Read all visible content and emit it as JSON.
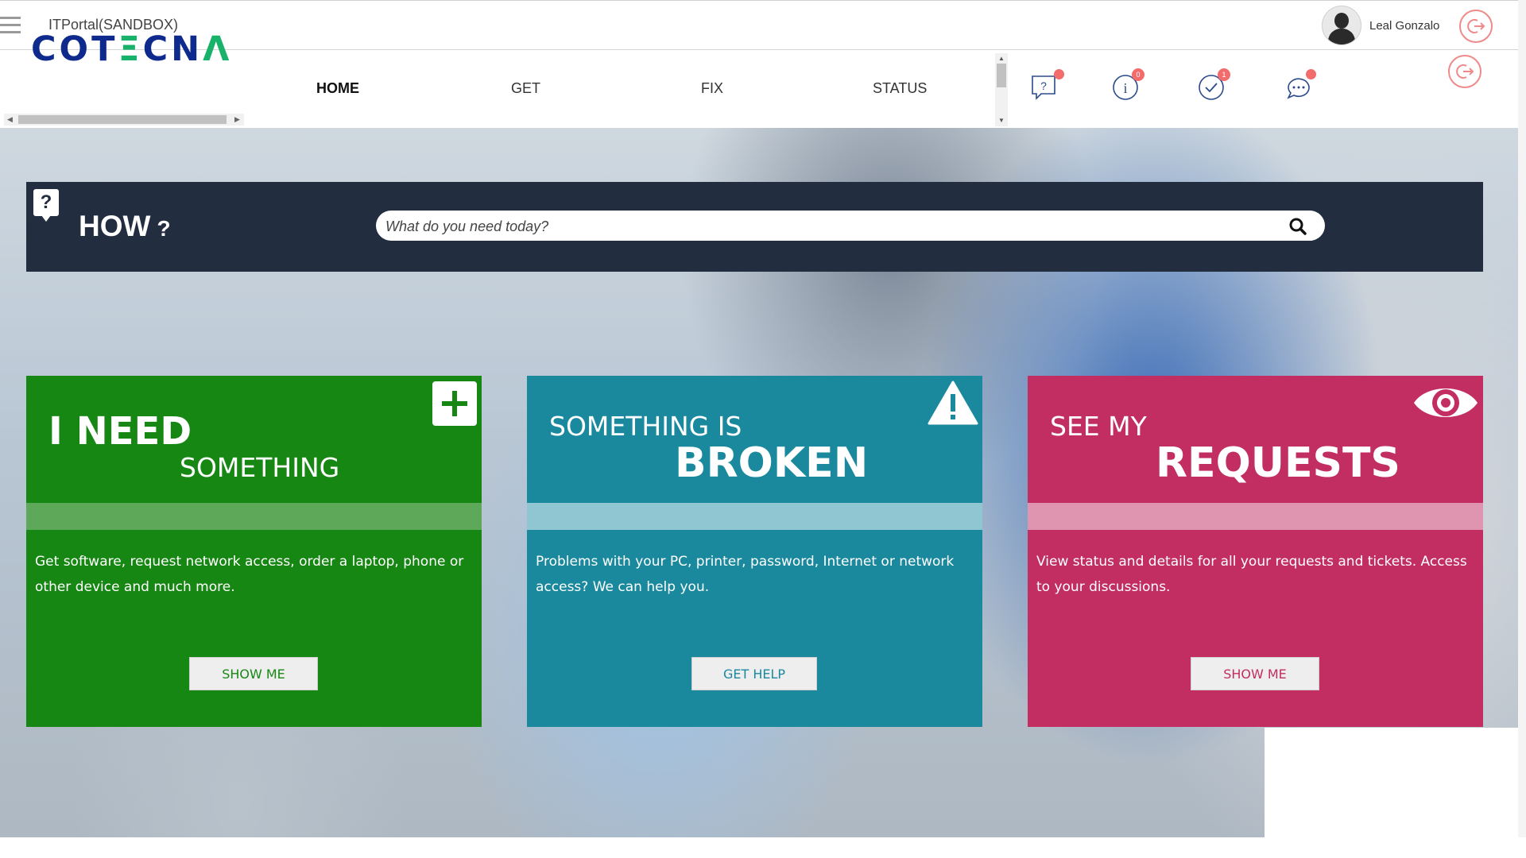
{
  "header": {
    "app_title": "ITPortal(SANDBOX)",
    "user_name": "Leal Gonzalo",
    "avatar_icon": "user-avatar-icon",
    "logout_icon": "logout-icon"
  },
  "logo": {
    "part1": "COT",
    "accent": "Ξ",
    "part2": "CN",
    "accent2": "Λ"
  },
  "nav": {
    "items": [
      {
        "label": "HOME",
        "active": true
      },
      {
        "label": "GET",
        "active": false
      },
      {
        "label": "FIX",
        "active": false
      },
      {
        "label": "STATUS",
        "active": false
      }
    ],
    "icons": [
      {
        "name": "help-chat-icon",
        "badge": ""
      },
      {
        "name": "info-icon",
        "badge": "0"
      },
      {
        "name": "approval-check-icon",
        "badge": "1"
      },
      {
        "name": "discussion-icon",
        "badge": ""
      }
    ],
    "badge_color": "#f26c6c"
  },
  "how": {
    "title": "HOW",
    "q": "?",
    "search_placeholder": "What do you need today?"
  },
  "cards": [
    {
      "line1": "I NEED",
      "line2": "SOMETHING",
      "description": "Get software, request network access, order a laptop, phone or other device and much more.",
      "button": "SHOW ME",
      "color": "#178713",
      "icon": "plus-icon"
    },
    {
      "line1": "SOMETHING IS",
      "line2": "BROKEN",
      "description": "Problems with your PC, printer, password, Internet or network access? We can help you.",
      "button": "GET HELP",
      "color": "#1a899e",
      "icon": "warning-icon"
    },
    {
      "line1": "SEE MY",
      "line2": "REQUESTS",
      "description": "View status and details for all your requests and tickets. Access to your discussions.",
      "button": "SHOW ME",
      "color": "#c22d62",
      "icon": "eye-icon"
    }
  ]
}
